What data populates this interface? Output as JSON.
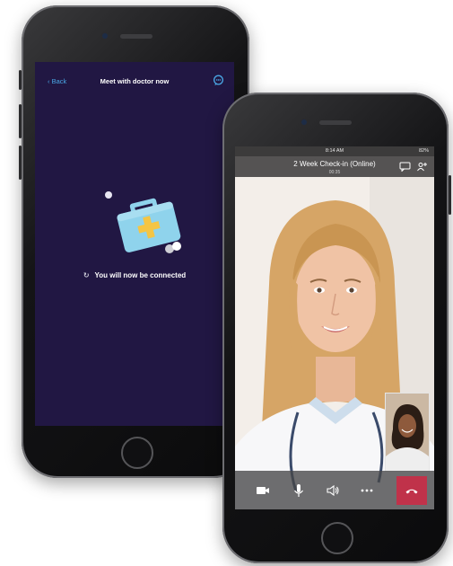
{
  "doctor_app": {
    "back_label": "Back",
    "header_title": "Meet with doctor now",
    "connecting_text": "You will now be connected",
    "colors": {
      "screen_bg": "#211743",
      "accent": "#4aa8e6",
      "kit": "#8fd3ec",
      "kit_cross": "#f4c544"
    }
  },
  "video_call": {
    "status_time": "8:14 AM",
    "status_battery": "82%",
    "call_title": "2 Week Check-in (Online)",
    "call_timer": "00:35",
    "controls": [
      "video-camera-icon",
      "microphone-icon",
      "speaker-icon",
      "more-options-icon",
      "end-call-icon"
    ],
    "colors": {
      "end_call": "#c0324a",
      "title_bar": "#555353"
    }
  }
}
